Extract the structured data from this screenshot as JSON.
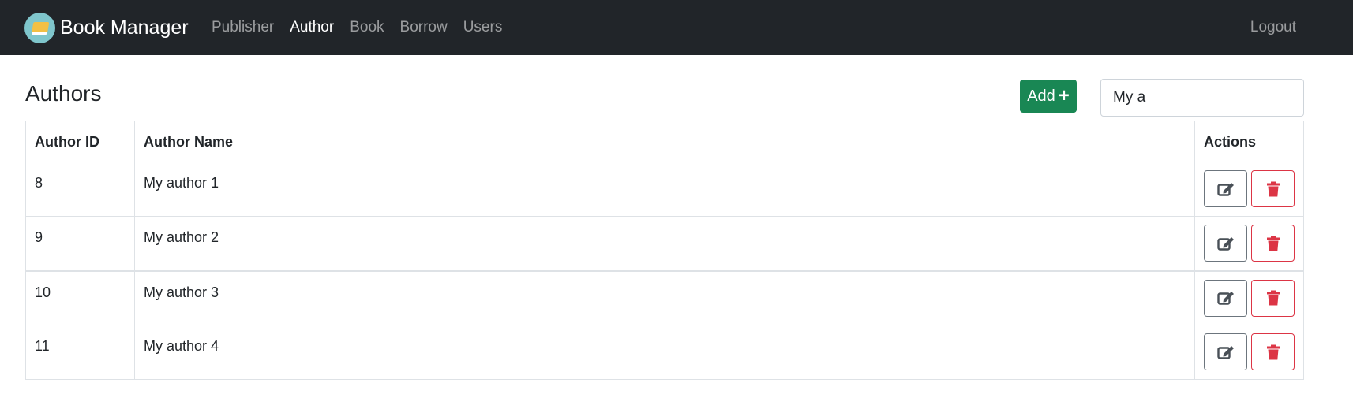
{
  "navbar": {
    "brand": "Book Manager",
    "links": [
      {
        "label": "Publisher"
      },
      {
        "label": "Author"
      },
      {
        "label": "Book"
      },
      {
        "label": "Borrow"
      },
      {
        "label": "Users"
      }
    ],
    "active": "Author",
    "logout": "Logout"
  },
  "page": {
    "title": "Authors",
    "add_label": "Add",
    "search_value": "My a"
  },
  "table": {
    "headers": [
      "Author ID",
      "Author Name",
      "Actions"
    ],
    "rows": [
      {
        "id": "8",
        "name": "My author 1"
      },
      {
        "id": "9",
        "name": "My author 2"
      },
      {
        "id": "10",
        "name": "My author 3"
      },
      {
        "id": "11",
        "name": "My author 4"
      }
    ]
  },
  "icons": {
    "add": "plus-icon",
    "edit": "edit-icon",
    "delete": "trash-icon",
    "logo": "book-logo-icon"
  },
  "colors": {
    "navbar_bg": "#212529",
    "add_button": "#198754",
    "delete_red": "#dc3545",
    "edit_gray": "#495057"
  }
}
